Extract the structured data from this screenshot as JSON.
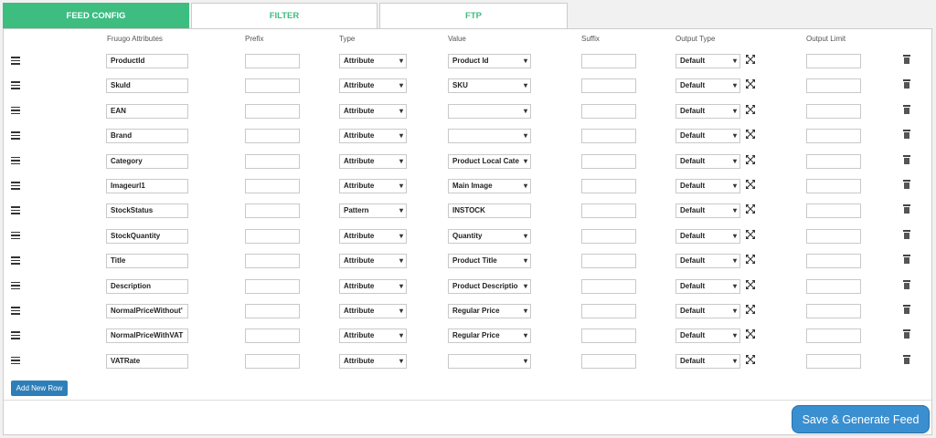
{
  "tabs": [
    {
      "label": "FEED CONFIG"
    },
    {
      "label": "FILTER"
    },
    {
      "label": "FTP"
    }
  ],
  "headers": {
    "attr": "Fruugo Attributes",
    "prefix": "Prefix",
    "type": "Type",
    "value": "Value",
    "suffix": "Suffix",
    "output_type": "Output Type",
    "output_limit": "Output Limit"
  },
  "rows": [
    {
      "attr": "ProductId",
      "type": "Attribute",
      "value": "Product Id",
      "value_select": true,
      "output": "Default"
    },
    {
      "attr": "SkuId",
      "type": "Attribute",
      "value": "SKU",
      "value_select": true,
      "output": "Default"
    },
    {
      "attr": "EAN",
      "type": "Attribute",
      "value": "",
      "value_select": true,
      "output": "Default"
    },
    {
      "attr": "Brand",
      "type": "Attribute",
      "value": "",
      "value_select": true,
      "output": "Default"
    },
    {
      "attr": "Category",
      "type": "Attribute",
      "value": "Product Local Cate",
      "value_select": true,
      "output": "Default"
    },
    {
      "attr": "Imageurl1",
      "type": "Attribute",
      "value": "Main Image",
      "value_select": true,
      "output": "Default"
    },
    {
      "attr": "StockStatus",
      "type": "Pattern",
      "value": "INSTOCK",
      "value_select": false,
      "output": "Default"
    },
    {
      "attr": "StockQuantity",
      "type": "Attribute",
      "value": "Quantity",
      "value_select": true,
      "output": "Default"
    },
    {
      "attr": "Title",
      "type": "Attribute",
      "value": "Product Title",
      "value_select": true,
      "output": "Default"
    },
    {
      "attr": "Description",
      "type": "Attribute",
      "value": "Product Descriptio",
      "value_select": true,
      "output": "Default"
    },
    {
      "attr": "NormalPriceWithout'",
      "type": "Attribute",
      "value": "Regular Price",
      "value_select": true,
      "output": "Default"
    },
    {
      "attr": "NormalPriceWithVAT",
      "type": "Attribute",
      "value": "Regular Price",
      "value_select": true,
      "output": "Default"
    },
    {
      "attr": "VATRate",
      "type": "Attribute",
      "value": "",
      "value_select": true,
      "output": "Default"
    }
  ],
  "buttons": {
    "add": "Add New Row",
    "save": "Save & Generate Feed"
  },
  "colors": {
    "active_tab": "#3dbd80",
    "add_button": "#2e7fb8",
    "save_button": "#3a8fd0"
  },
  "icons": {
    "drag": "drag-handle-icon",
    "format": "expand-arrows-icon",
    "delete": "trash-icon"
  }
}
